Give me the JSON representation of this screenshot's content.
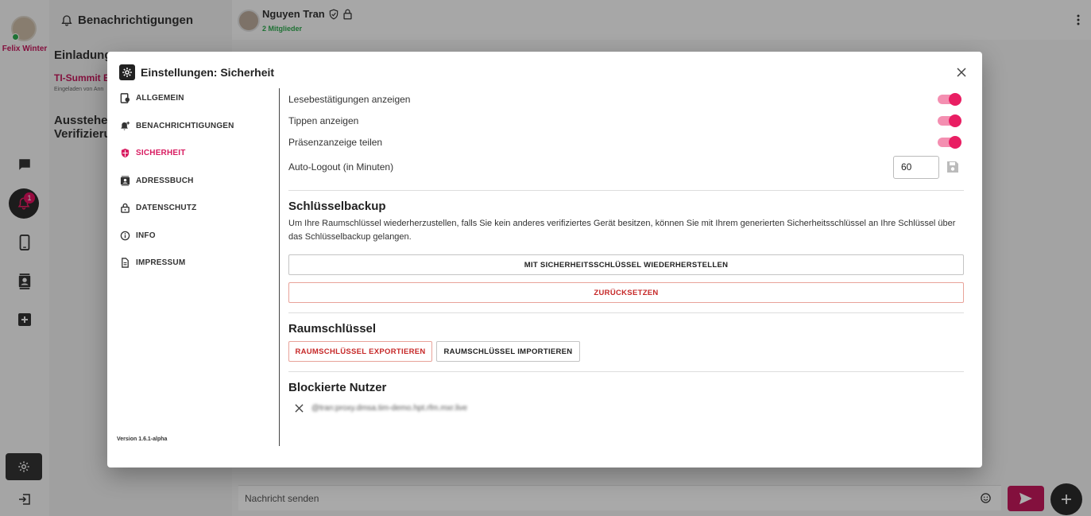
{
  "rail": {
    "user_name": "Felix Winter",
    "notification_badge": "1",
    "icons": [
      "chat-icon",
      "bell-icon",
      "device-icon",
      "contacts-icon",
      "add-box-icon",
      "gear-icon",
      "logout-icon"
    ]
  },
  "notifications_panel": {
    "title": "Benachrichtigungen",
    "section_invitations": "Einladung",
    "invite_title": "TI-Summit E",
    "invite_sub": "Eingeladen von Ann",
    "section_pending_line1": "Ausstehen",
    "section_pending_line2": "Verifizieru"
  },
  "chat": {
    "contact_name": "Nguyen Tran",
    "members": "2 Mitglieder",
    "message_placeholder": "Nachricht senden"
  },
  "dialog": {
    "title": "Einstellungen: Sicherheit",
    "nav": [
      {
        "label": "ALLGEMEIN",
        "icon": "settings-app-icon"
      },
      {
        "label": "BENACHRICHTIGUNGEN",
        "icon": "bell-plus-icon"
      },
      {
        "label": "SICHERHEIT",
        "icon": "shield-icon"
      },
      {
        "label": "ADRESSBUCH",
        "icon": "contacts-icon"
      },
      {
        "label": "DATENSCHUTZ",
        "icon": "lock-icon"
      },
      {
        "label": "INFO",
        "icon": "info-icon"
      },
      {
        "label": "IMPRESSUM",
        "icon": "document-icon"
      }
    ],
    "version": "Version 1.6.1-alpha",
    "settings": {
      "read_receipts_label": "Lesebestätigungen anzeigen",
      "typing_label": "Tippen anzeigen",
      "presence_label": "Präsenzanzeige teilen",
      "auto_logout_label": "Auto-Logout (in Minuten)",
      "auto_logout_value": "60"
    },
    "key_backup": {
      "title": "Schlüsselbackup",
      "description": "Um Ihre Raumschlüssel wiederherzustellen, falls Sie kein anderes verifiziertes Gerät besitzen, können Sie mit Ihrem generierten Sicherheitsschlüssel an Ihre Schlüssel über das Schlüsselbackup gelangen.",
      "restore_button": "MIT SICHERHEITSSCHLÜSSEL WIEDERHERSTELLEN",
      "reset_button": "ZURÜCKSETZEN"
    },
    "room_keys": {
      "title": "Raumschlüssel",
      "export_button": "RAUMSCHLÜSSEL EXPORTIEREN",
      "import_button": "RAUMSCHLÜSSEL IMPORTIEREN"
    },
    "blocked_users": {
      "title": "Blockierte Nutzer",
      "entries": [
        "@tran:proxy.dmsa.tim-demo.hpt.rfm.mxr.live"
      ]
    }
  },
  "colors": {
    "accent": "#d81b60",
    "toggle_track": "#f48fb1",
    "toggle_knob": "#e91e63",
    "danger": "#c62828",
    "online": "#2fa84f"
  }
}
